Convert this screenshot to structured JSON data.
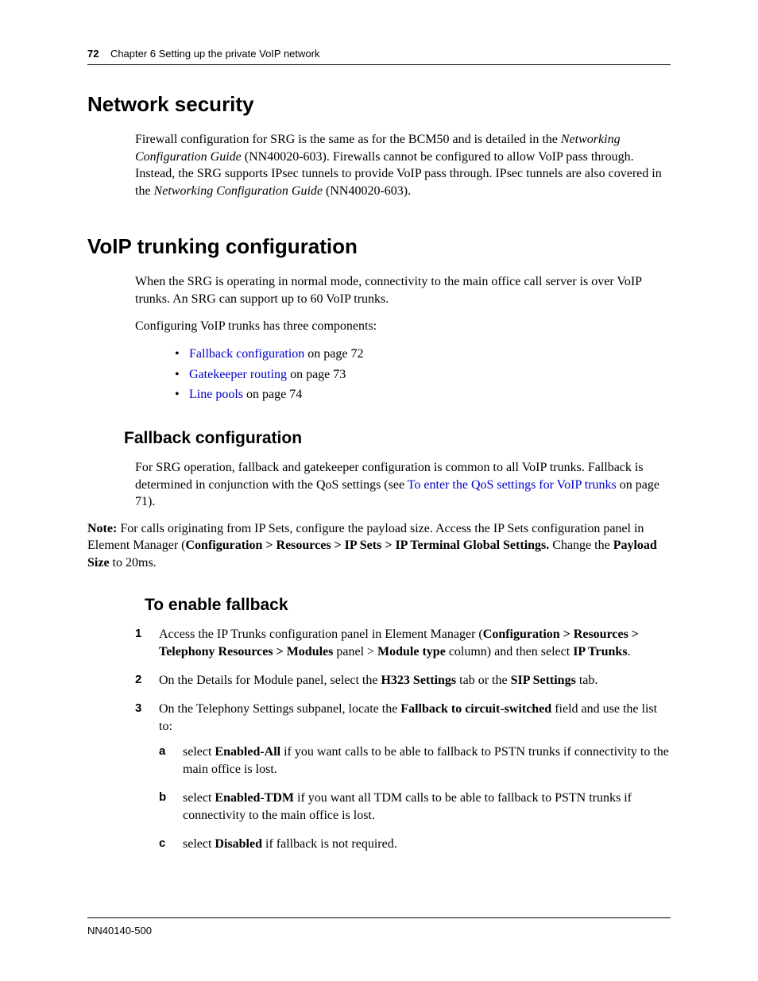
{
  "header": {
    "page_number": "72",
    "chapter": "Chapter 6  Setting up the private VoIP network"
  },
  "sections": {
    "network_security": {
      "title": "Network security",
      "p1_a": "Firewall configuration for SRG is the same as for the BCM50 and is detailed in the ",
      "p1_i1": "Networking Configuration Guide",
      "p1_b": " (NN40020-603). Firewalls cannot be configured to allow VoIP pass through. Instead, the SRG supports IPsec tunnels to provide VoIP pass through. IPsec tunnels are also covered in the ",
      "p1_i2": "Networking Configuration Guide",
      "p1_c": " (NN40020-603)."
    },
    "voip": {
      "title": "VoIP trunking configuration",
      "p1": "When the SRG is operating in normal mode, connectivity to the main office call server is over VoIP trunks. An SRG can support up to 60 VoIP trunks.",
      "p2": "Configuring VoIP trunks has three components:",
      "bullets": [
        {
          "link": "Fallback configuration",
          "tail": " on page 72"
        },
        {
          "link": "Gatekeeper routing",
          "tail": " on page 73"
        },
        {
          "link": "Line pools",
          "tail": " on page 74"
        }
      ]
    },
    "fallback": {
      "title": "Fallback configuration",
      "p1_a": "For SRG operation, fallback and gatekeeper configuration is common to all VoIP trunks. Fallback is determined in conjunction with the QoS settings (see ",
      "p1_link": "To enter the QoS settings for VoIP trunks",
      "p1_b": " on page 71)."
    },
    "note": {
      "lead": "Note:",
      "a": " For calls originating from IP Sets, configure the payload size. Access the IP Sets configuration panel in Element Manager (",
      "b1": "Configuration > Resources > IP Sets > IP Terminal Global Settings.",
      "c": " Change the ",
      "b2": "Payload Size",
      "d": " to 20ms."
    },
    "enable": {
      "title": "To enable fallback",
      "steps": {
        "s1": {
          "n": "1",
          "a": "Access the IP Trunks configuration panel in Element Manager (",
          "b1": "Configuration > Resources > Telephony Resources > Modules",
          "c": " panel > ",
          "b2": "Module type",
          "d": " column) and then select ",
          "b3": "IP Trunks",
          "e": "."
        },
        "s2": {
          "n": "2",
          "a": "On the Details for Module panel, select the ",
          "b1": "H323 Settings",
          "c": " tab or the ",
          "b2": "SIP Settings",
          "d": " tab."
        },
        "s3": {
          "n": "3",
          "a": "On the Telephony Settings subpanel, locate the ",
          "b1": "Fallback to circuit-switched",
          "c": " field and use the list to:",
          "subs": {
            "a": {
              "n": "a",
              "pre": "select ",
              "b": "Enabled-All",
              "post": " if you want calls to be able to fallback to PSTN trunks if connectivity to the main office is lost."
            },
            "b": {
              "n": "b",
              "pre": "select ",
              "b": "Enabled-TDM",
              "post": " if you want all TDM calls to be able to fallback to PSTN trunks if connectivity to the main office is lost."
            },
            "c": {
              "n": "c",
              "pre": "select ",
              "b": "Disabled",
              "post": " if fallback is not required."
            }
          }
        }
      }
    }
  },
  "footer": {
    "doc_id": "NN40140-500"
  }
}
